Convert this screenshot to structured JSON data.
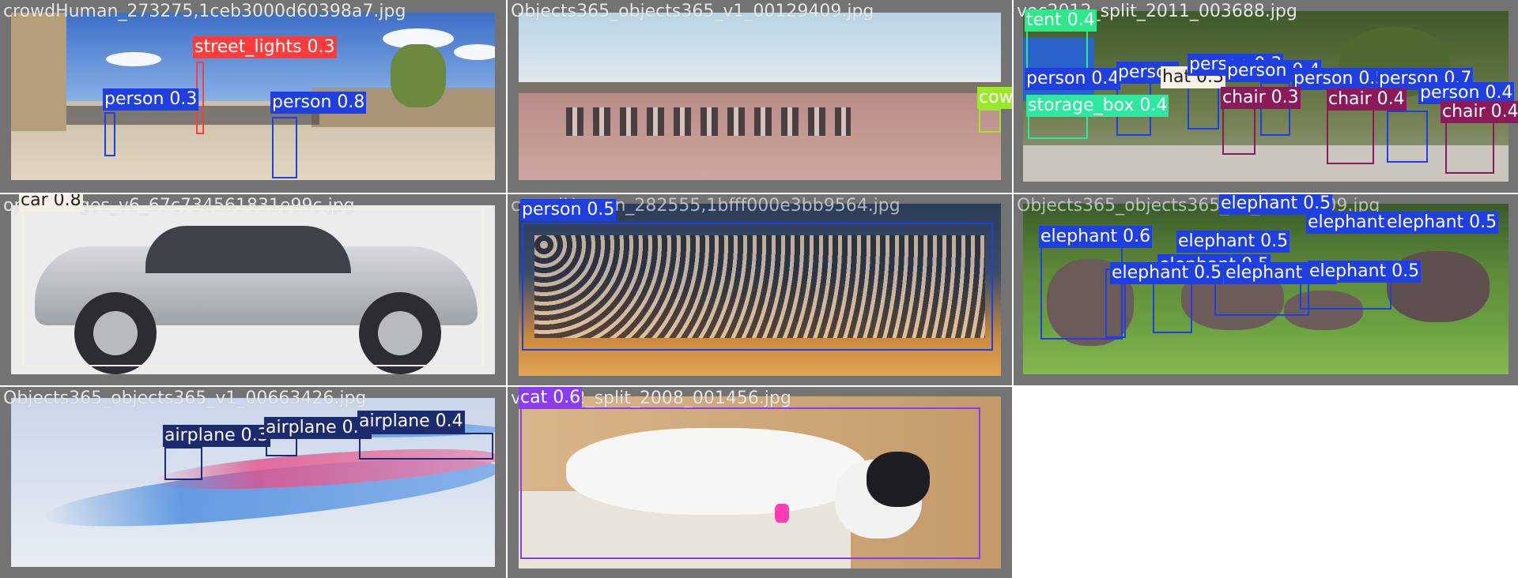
{
  "tiles": [
    {
      "filename": "crowdHuman_273275,1ceb3000d60398a7.jpg",
      "detections": [
        {
          "label": "street_lights 0.3",
          "color": "#ff3b3b"
        },
        {
          "label": "person 0.3",
          "color": "#1f3fe0"
        },
        {
          "label": "person 0.8",
          "color": "#1f3fe0"
        }
      ]
    },
    {
      "filename": "Objects365_objects365_v1_00129409.jpg",
      "detections": [
        {
          "label": "cow",
          "color": "#9be82a"
        }
      ]
    },
    {
      "filename": "voc2012_split_2011_003688.jpg",
      "detections": [
        {
          "label": "tent 0.4",
          "color": "#2ee88a"
        },
        {
          "label": "person 0.4",
          "color": "#1f3fe0"
        },
        {
          "label": "person",
          "color": "#1f3fe0"
        },
        {
          "label": "hat 0.3",
          "color": "#f5f0e6"
        },
        {
          "label": "person 0.3",
          "color": "#1f3fe0"
        },
        {
          "label": "person 0.4",
          "color": "#1f3fe0"
        },
        {
          "label": "person 0.5",
          "color": "#1f3fe0"
        },
        {
          "label": "person 0.7",
          "color": "#1f3fe0"
        },
        {
          "label": "storage_box 0.4",
          "color": "#2ee8a0"
        },
        {
          "label": "chair 0.3",
          "color": "#8a1a5a"
        },
        {
          "label": "chair 0.4",
          "color": "#8a1a5a"
        },
        {
          "label": "person 0.4",
          "color": "#1f3fe0"
        },
        {
          "label": "chair 0.4",
          "color": "#8a1a5a"
        }
      ]
    },
    {
      "filename": "openimages_v6_67c734561831e99c.jpg",
      "detections": [
        {
          "label": "car 0.8",
          "color": "#f5f0e6"
        }
      ]
    },
    {
      "filename": "crowdHuman_282555,1bfff000e3bb9564.jpg",
      "detections": [
        {
          "label": "person 0.5",
          "color": "#1f3fe0"
        }
      ]
    },
    {
      "filename": "Objects365_objects365_v1_00129409.jpg",
      "detections": [
        {
          "label": "elephant 0.5",
          "color": "#1f3fe0"
        },
        {
          "label": "elephant 0.6",
          "color": "#1f3fe0"
        },
        {
          "label": "elephant 0.5",
          "color": "#1f3fe0"
        },
        {
          "label": "elephant 0.5",
          "color": "#1f3fe0"
        },
        {
          "label": "elephant 0.5",
          "color": "#1f3fe0"
        },
        {
          "label": "elephant 0.5",
          "color": "#1f3fe0"
        },
        {
          "label": "elephant 0.5",
          "color": "#1f3fe0"
        },
        {
          "label": "elephant 0.5",
          "color": "#1f3fe0"
        },
        {
          "label": "elephant 0.5",
          "color": "#1f3fe0"
        }
      ]
    },
    {
      "filename": "Objects365_objects365_v1_00663426.jpg",
      "detections": [
        {
          "label": "airplane 0.3",
          "color": "#1c2a6e"
        },
        {
          "label": "airplane 0.4",
          "color": "#1c2a6e"
        },
        {
          "label": "airplane 0.4",
          "color": "#1c2a6e"
        }
      ]
    },
    {
      "filename": "voc2012_split_2008_001456.jpg",
      "detections": [
        {
          "label": "cat 0.6",
          "color": "#8a3cf0"
        }
      ]
    }
  ]
}
